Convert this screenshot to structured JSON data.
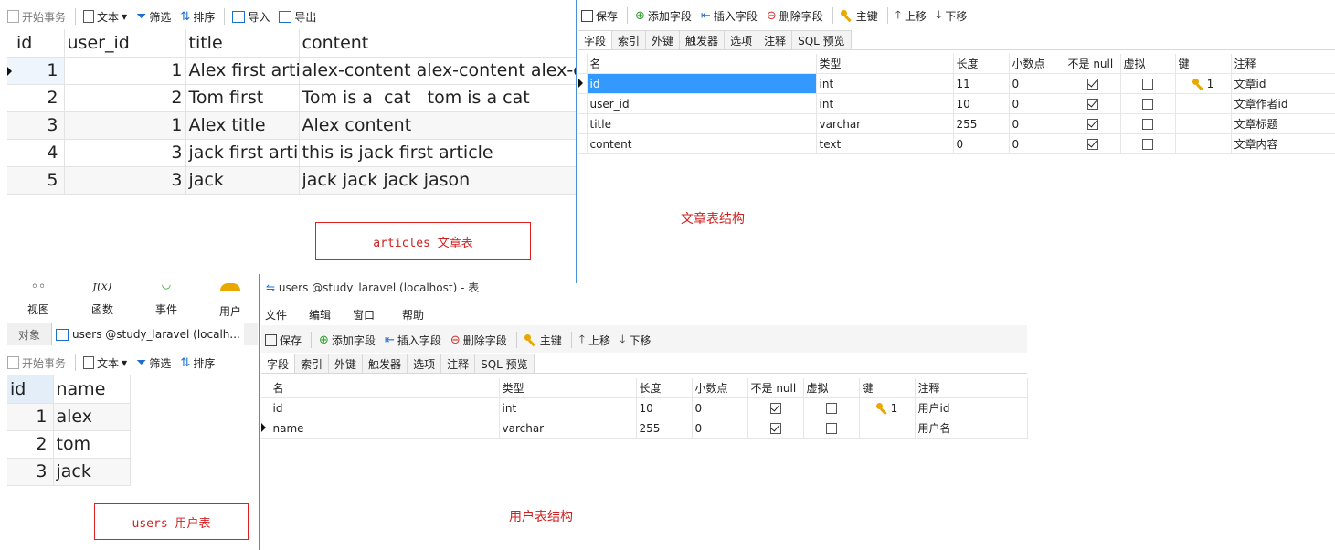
{
  "articles_grid": {
    "toolbar": {
      "begin_tx": "开始事务",
      "text": "文本",
      "filter": "筛选",
      "sort": "排序",
      "import": "导入",
      "export": "导出"
    },
    "columns": [
      "id",
      "user_id",
      "title",
      "content"
    ],
    "rows": [
      {
        "id": "1",
        "user_id": "1",
        "title": "Alex first article",
        "content": "alex-content alex-content alex-content"
      },
      {
        "id": "2",
        "user_id": "2",
        "title": "Tom first",
        "content": "Tom is a  cat   tom is a cat"
      },
      {
        "id": "3",
        "user_id": "1",
        "title": "Alex title",
        "content": "Alex content"
      },
      {
        "id": "4",
        "user_id": "3",
        "title": "jack first article",
        "content": "this is jack first article"
      },
      {
        "id": "5",
        "user_id": "3",
        "title": "jack",
        "content": "jack jack jack jason"
      }
    ],
    "caption": "articles 文章表"
  },
  "articles_design": {
    "toolbar": {
      "save": "保存",
      "add_field": "添加字段",
      "insert_field": "插入字段",
      "delete_field": "删除字段",
      "primary_key": "主键",
      "move_up": "上移",
      "move_down": "下移"
    },
    "tabs": [
      "字段",
      "索引",
      "外键",
      "触发器",
      "选项",
      "注释",
      "SQL 预览"
    ],
    "headers": [
      "名",
      "类型",
      "长度",
      "小数点",
      "不是 null",
      "虚拟",
      "键",
      "注释"
    ],
    "fields": [
      {
        "name": "id",
        "type": "int",
        "length": "11",
        "decimals": "0",
        "not_null": true,
        "virtual": false,
        "key": "1",
        "comment": "文章id"
      },
      {
        "name": "user_id",
        "type": "int",
        "length": "10",
        "decimals": "0",
        "not_null": true,
        "virtual": false,
        "key": "",
        "comment": "文章作者id"
      },
      {
        "name": "title",
        "type": "varchar",
        "length": "255",
        "decimals": "0",
        "not_null": true,
        "virtual": false,
        "key": "",
        "comment": "文章标题"
      },
      {
        "name": "content",
        "type": "text",
        "length": "0",
        "decimals": "0",
        "not_null": true,
        "virtual": false,
        "key": "",
        "comment": "文章内容"
      }
    ],
    "caption": "文章表结构"
  },
  "users_side": {
    "top_icons": [
      "视图",
      "函数",
      "事件",
      "用户"
    ],
    "tab_objects": "对象",
    "tab_users": "users @study_laravel (localh...",
    "toolbar": {
      "begin_tx": "开始事务",
      "text": "文本",
      "filter": "筛选",
      "sort": "排序"
    },
    "columns": [
      "id",
      "name"
    ],
    "rows": [
      {
        "id": "1",
        "name": "alex"
      },
      {
        "id": "2",
        "name": "tom"
      },
      {
        "id": "3",
        "name": "jack"
      }
    ],
    "caption": "users 用户表"
  },
  "users_design": {
    "window_title": "users @study_laravel (localhost) - 表",
    "menu": [
      "文件",
      "编辑",
      "窗口",
      "帮助"
    ],
    "toolbar": {
      "save": "保存",
      "add_field": "添加字段",
      "insert_field": "插入字段",
      "delete_field": "删除字段",
      "primary_key": "主键",
      "move_up": "上移",
      "move_down": "下移"
    },
    "tabs": [
      "字段",
      "索引",
      "外键",
      "触发器",
      "选项",
      "注释",
      "SQL 预览"
    ],
    "headers": [
      "名",
      "类型",
      "长度",
      "小数点",
      "不是 null",
      "虚拟",
      "键",
      "注释"
    ],
    "fields": [
      {
        "name": "id",
        "type": "int",
        "length": "10",
        "decimals": "0",
        "not_null": true,
        "virtual": false,
        "key": "1",
        "comment": "用户id"
      },
      {
        "name": "name",
        "type": "varchar",
        "length": "255",
        "decimals": "0",
        "not_null": true,
        "virtual": false,
        "key": "",
        "comment": "用户名"
      }
    ],
    "caption": "用户表结构"
  },
  "colors": {
    "annotation_red": "#d02020",
    "selection_blue": "#3399ff",
    "key_gold": "#e8a800"
  }
}
